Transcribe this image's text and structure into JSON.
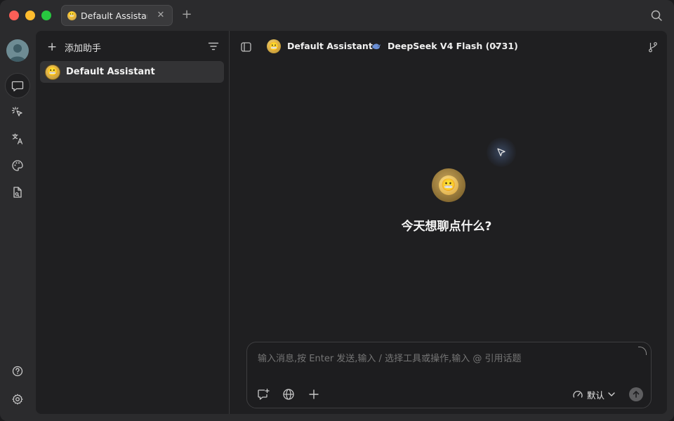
{
  "window": {
    "tab": {
      "title": "Default Assistant",
      "emoji": "😬"
    }
  },
  "rail": {
    "items": [
      {
        "name": "chat",
        "icon": "chat-bubble-icon",
        "active": true
      },
      {
        "name": "agents",
        "icon": "sparkle-cursor-icon"
      },
      {
        "name": "translate",
        "icon": "translate-icon"
      },
      {
        "name": "paintings",
        "icon": "palette-icon"
      },
      {
        "name": "files",
        "icon": "file-icon"
      }
    ],
    "bottom": [
      {
        "name": "help",
        "icon": "help-icon"
      },
      {
        "name": "settings",
        "icon": "gear-icon"
      }
    ]
  },
  "assistants_panel": {
    "add_label": "添加助手",
    "items": [
      {
        "label": "Default Assistant",
        "emoji": "😬"
      }
    ]
  },
  "chat_header": {
    "assistant_name": "Default Assistant",
    "assistant_emoji": "😬",
    "model_name": "DeepSeek V4 Flash (0731)"
  },
  "chat_body": {
    "emoji": "😬",
    "welcome_text": "今天想聊点什么?"
  },
  "composer": {
    "placeholder": "输入消息,按 Enter 发送,输入 / 选择工具或操作,输入 @ 引用话题",
    "mode_label": "默认"
  },
  "colors": {
    "background": "#1f1f21",
    "rail": "#2b2b2d",
    "accent_close": "#fe5f57",
    "accent_min": "#febc2e",
    "accent_max": "#28c840"
  }
}
